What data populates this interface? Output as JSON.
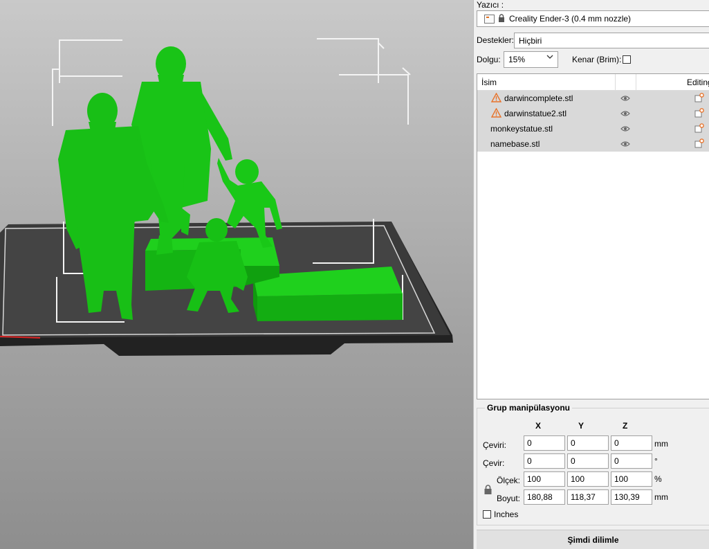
{
  "sidebar": {
    "printer_label": "Yazıcı :",
    "printer_value": "Creality Ender-3 (0.4 mm nozzle)",
    "supports_label": "Destekler:",
    "supports_value": "Hiçbiri",
    "infill_label": "Dolgu:",
    "infill_value": "15%",
    "brim_label": "Kenar (Brim):",
    "brim_checked": false
  },
  "object_list": {
    "col_name": "İsim",
    "col_editing": "Editing",
    "items": [
      {
        "name": "darwincomplete.stl",
        "warning": true
      },
      {
        "name": "darwinstatue2.stl",
        "warning": true
      },
      {
        "name": "monkeystatue.stl",
        "warning": false
      },
      {
        "name": "namebase.stl",
        "warning": false
      }
    ]
  },
  "manipulation": {
    "title": "Grup manipülasyonu",
    "axes": [
      "X",
      "Y",
      "Z"
    ],
    "translate_label": "Çeviri:",
    "translate": [
      "0",
      "0",
      "0"
    ],
    "translate_unit": "mm",
    "rotate_label": "Çevir:",
    "rotate": [
      "0",
      "0",
      "0"
    ],
    "rotate_unit": "°",
    "scale_label": "Ölçek:",
    "scale": [
      "100",
      "100",
      "100"
    ],
    "scale_unit": "%",
    "size_label": "Boyut:",
    "size": [
      "180,88",
      "118,37",
      "130,39"
    ],
    "size_unit": "mm",
    "inches_label": "Inches"
  },
  "slice_button": "Şimdi dilimle",
  "colors": {
    "model_green": "#16c814",
    "bed_dark": "#2a2a2a",
    "warning_orange": "#e8732a"
  }
}
